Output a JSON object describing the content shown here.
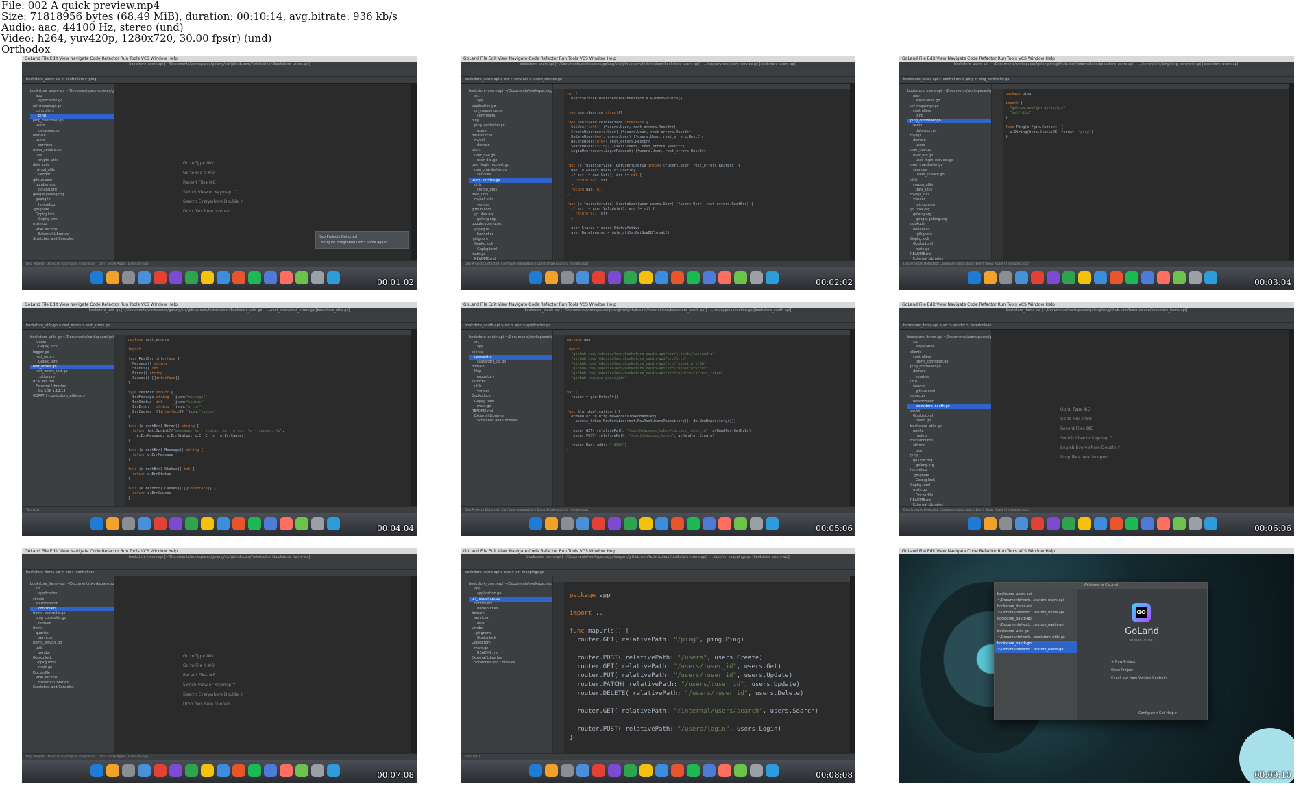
{
  "header": {
    "line1": "File: 002 A quick preview.mp4",
    "line2": "Size: 71818956 bytes (68.49 MiB), duration: 00:10:14, avg.bitrate: 936 kb/s",
    "line3": "Audio: aac, 44100 Hz, stereo (und)",
    "line4": "Video: h264, yuv420p, 1280x720, 30.00 fps(r) (und)",
    "line5": "Orthodox"
  },
  "mac_menu": "GoLand  File  Edit  View  Navigate  Code  Refactor  Run  Tools  VCS  Window  Help",
  "frames": [
    {
      "timestamp": "00:01:02",
      "title": "bookstore_users-api [~/Documents/workspaces/golang/src/github.com/federicoleon/bookstore_users-api]",
      "crumbs": "bookstore_users-api  >  controllers  >  ping",
      "tree": [
        "bookstore_users-api ~/Documents/workspaces/golang",
        "app",
        "application.go",
        "url_mappings.go",
        "controllers",
        "ping",
        "ping_controller.go",
        "users",
        "datasources",
        "domain",
        "users",
        "services",
        "users_service.go",
        "utils",
        "crypto_utils",
        "date_utils",
        "mysql_utils",
        "vendor",
        "github.com",
        "go.uber.org",
        "golang.org",
        "google.golang.org",
        "gopkg.in",
        "honnef.co",
        ".gitignore",
        "Gopkg.lock",
        "Gopkg.toml",
        "main.go",
        "README.md",
        "External Libraries",
        "Scratches and Consoles"
      ],
      "selected": 5,
      "welcome": [
        "Go to Type  ⌘O",
        "Go to File  ⇧⌘O",
        "Recent Files  ⌘E",
        "Switch View or Keymap  ^`",
        "Search Everywhere  Double ⇧",
        "Drop files here to open"
      ],
      "notify": [
        "Dep Projects Detected",
        "Configure integration   Don't Show Again"
      ],
      "status": "Dep Projects Detected: Configure integration | Don't Show Again (a minute ago)"
    },
    {
      "timestamp": "00:02:02",
      "title": "bookstore_users-api [~/Documents/workspaces/golang/src/github.com/federicoleon/bookstore_users-api] - .../src/services/users_service.go [bookstore_users-api]",
      "crumbs": "bookstore_users-api  >  src  >  services  >  users_service.go",
      "tree": [
        "bookstore_users-api ~/Documents/workspaces/golang",
        "src",
        "app",
        "application.go",
        "url_mappings.go",
        "controllers",
        "ping",
        "ping_controller.go",
        "users",
        "datasources",
        "mysql",
        "domain",
        "users",
        "user_dao.go",
        "user_dto.go",
        "user_login_request.go",
        "user_marshaller.go",
        "services",
        "users_service.go",
        "utils",
        "crypto_utils",
        "date_utils",
        "mysql_utils",
        "vendor",
        "github.com",
        "go.uber.org",
        "golang.org",
        "google.golang.org",
        "gopkg.in",
        "honnef.co",
        ".gitignore",
        "Gopkg.lock",
        "Gopkg.toml",
        "main.go",
        "README.md",
        "External Libraries"
      ],
      "selected": 18,
      "code": [
        "var (",
        "  UsersService usersServiceInterface = &usersService{}",
        ")",
        "",
        "type usersService struct{}",
        "",
        "type usersServiceInterface interface {",
        "  GetUser(int64) (*users.User, rest_errors.RestErr)",
        "  CreateUser(users.User) (*users.User, rest_errors.RestErr)",
        "  UpdateUser(bool, users.User) (*users.User, rest_errors.RestErr)",
        "  DeleteUser(int64) rest_errors.RestErr",
        "  SearchUser(string) (users.Users, rest_errors.RestErr)",
        "  LoginUser(users.LoginRequest) (*users.User, rest_errors.RestErr)",
        "}",
        "",
        "func (s *usersService) GetUser(userId int64) (*users.User, rest_errors.RestErr) {",
        "  dao := &users.User{Id: userId}",
        "  if err := dao.Get(); err != nil {",
        "    return nil, err",
        "  }",
        "  return dao, nil",
        "}",
        "",
        "func (s *usersService) CreateUser(user users.User) (*users.User, rest_errors.RestErr) {",
        "  if err := user.Validate(); err != nil {",
        "    return nil, err",
        "  }",
        "",
        "  user.Status = users.StatusActive",
        "  user.DateCreated = date_utils.GetNowDBFormat()"
      ],
      "status": "Dep Projects Detected: Configure integration | Don't Show Again (a minute ago)"
    },
    {
      "timestamp": "00:03:04",
      "title": "bookstore_users-api [~/Documents/workspaces/golang/src/github.com/federicoleon/bookstore_users-api] - .../controllers/ping/ping_controller.go [bookstore_users-api]",
      "crumbs": "bookstore_users-api  >  controllers  >  ping  >  ping_controller.go",
      "tree": [
        "bookstore_users-api ~/Documents/workspaces/golang",
        "app",
        "application.go",
        "url_mappings.go",
        "controllers",
        "ping",
        "ping_controller.go",
        "users",
        "datasources",
        "mysql",
        "domain",
        "users",
        "user_dao.go",
        "user_dto.go",
        "user_login_request.go",
        "user_marshaller.go",
        "services",
        "users_service.go",
        "utils",
        "crypto_utils",
        "date_utils",
        "mysql_utils",
        "vendor",
        "github.com",
        "go.uber.org",
        "golang.org",
        "google.golang.org",
        "gopkg.in",
        "honnef.co",
        ".gitignore",
        "Gopkg.lock",
        "Gopkg.toml",
        "main.go",
        "README.md",
        "External Libraries"
      ],
      "selected": 6,
      "code": [
        "package ping",
        "",
        "import (",
        "  \"github.com/gin-gonic/gin\"",
        "  \"net/http\"",
        ")",
        "",
        "func Ping(c *gin.Context) {",
        "  c.String(http.StatusOK, format: \"pong\")",
        "}"
      ],
      "status": "Dep Projects Detected: Configure integration | Don't Show Again (2 minutes ago)"
    },
    {
      "timestamp": "00:04:04",
      "title": "bookstore_utils-go [~/Documents/workspaces/golang/src/github.com/federicoleon/bookstore_utils-go] - .../rest_errors/rest_errors.go [bookstore_utils-go]",
      "crumbs": "bookstore_utils-go  >  rest_errors  >  rest_errors.go",
      "tree": [
        "bookstore_utils-go ~/Documents/workspaces/golang",
        "logger",
        "Gopkg.lock",
        "logger.go",
        "rest_errors",
        "Gopkg.toml",
        "rest_errors.go",
        "rest_errors_test.go",
        ".gitignore",
        "README.md",
        "External Libraries",
        "Go SDK 1.12.13",
        "GOPATH <bookstore_utils-go>"
      ],
      "selected": 6,
      "code": [
        "package rest_errors",
        "",
        "import ...",
        "",
        "type RestErr interface {",
        "  Message() string",
        "  Status() int",
        "  Error() string",
        "  Causes() []interface{}",
        "}",
        "",
        "type restErr struct {",
        "  ErrMessage string  `json:\"message\"`",
        "  ErrStatus  int     `json:\"status\"`",
        "  ErrError   string  `json:\"error\"`",
        "  ErrCauses  []interface{} `json:\"causes\"`",
        "}",
        "",
        "func (e restErr) Error() string {",
        "  return fmt.Sprintf(\"message: %s - status: %d - error: %s - causes: %v\",",
        "    e.ErrMessage, e.ErrStatus, e.ErrError, e.ErrCauses)",
        "}",
        "",
        "func (e restErr) Message() string {",
        "  return e.ErrMessage",
        "}",
        "",
        "func (e restErr) Status() int {",
        "  return e.ErrStatus",
        "}",
        "",
        "func (e restErr) Causes() []interface{} {",
        "  return e.ErrCauses",
        "}",
        "",
        "func NewRestError(message string, status int, err string, causes []interface{}) RestErr {",
        "  return restErr{",
        "    ErrMessage: message,",
        "    ErrStatus:  status,",
        "    ErrError:   err,",
        "    ErrCauses:  causes,",
        "  }",
        "}"
      ],
      "status": "Terminal"
    },
    {
      "timestamp": "00:05:06",
      "title": "bookstore_oauth-api [~/Documents/workspaces/golang/src/github.com/federicoleon/bookstore_oauth-api] - .../src/app/application.go [bookstore_oauth-api]",
      "crumbs": "bookstore_oauth-api  >  src  >  app  >  application.go",
      "tree": [
        "bookstore_oauth-api ~/Documents/workspaces/golang",
        "src",
        "app",
        "clients",
        "cassandra",
        "cassandra_db.go",
        "domain",
        "http",
        "repository",
        "services",
        "utils",
        "vendor",
        "Gopkg.lock",
        "Gopkg.toml",
        "main.go",
        "README.md",
        "External Libraries",
        "Scratches and Consoles"
      ],
      "selected": 4,
      "code": [
        "package app",
        "",
        "import (",
        "  \"github.com/federicoleon/bookstore_oauth-api/src/clients/cassandra\"",
        "  \"github.com/federicoleon/bookstore_oauth-api/src/http\"",
        "  \"github.com/federicoleon/bookstore_oauth-api/src/repository/db\"",
        "  \"github.com/federicoleon/bookstore_oauth-api/src/repository/rest\"",
        "  \"github.com/federicoleon/bookstore_oauth-api/src/services/access_token\"",
        "  \"github.com/gin-gonic/gin\"",
        ")",
        "",
        "var (",
        "  router = gin.Default()",
        ")",
        "",
        "func StartApplication() {",
        "  atHandler := http.NewAccessTokenHandler(",
        "    access_token.NewService(rest.NewRestUsersRepository(), db.NewRepository()))",
        "",
        "  router.GET( relativePath: \"/oauth/access_token/:access_token_id\", atHandler.GetById)",
        "  router.POST( relativePath: \"/oauth/access_token\", atHandler.Create)",
        "",
        "  router.Run( addr: \":8080\")",
        "}"
      ],
      "status": "Dep Projects Detected: Configure integration | Don't Show Again (a minute ago)"
    },
    {
      "timestamp": "00:06:06",
      "title": "bookstore_items-api [~/Documents/workspaces/golang/src/github.com/federicoleon/bookstore_items-api]",
      "crumbs": "bookstore_items-api  >  src  >  vendor  >  federicoleon",
      "tree": [
        "bookstore_items-api ~/Documents/workspaces/golang",
        "src",
        "application",
        "clients",
        "controllers",
        "items_controller.go",
        "ping_controller.go",
        "domain",
        "services",
        "utils",
        "vendor",
        "github.com",
        "davecgh",
        "federicoleon",
        "bookstore_oauth-go",
        "oauth",
        "Gopkg.toml",
        "oauth.go",
        "bookstore_utils-go",
        "gorilla",
        "mailru",
        "mercadolibre",
        "olivere",
        "pkg",
        "ping",
        "go.uber.org",
        "golang.org",
        "honnef.co",
        ".gitignore",
        "Gopkg.lock",
        "Gopkg.toml",
        "main.go",
        "Dockerfile",
        "README.md",
        "External Libraries",
        "Scratches and Consoles"
      ],
      "selected": 14,
      "welcome": [
        "Go to Type  ⌘O",
        "Go to File  ⇧⌘O",
        "Recent Files  ⌘E",
        "Switch View or Keymap  ^`",
        "Search Everywhere  Double ⇧",
        "Drop files here to open"
      ],
      "status": "Dep Projects Detected: Configure integration | Don't Show Again (2 minutes ago)"
    },
    {
      "timestamp": "00:07:08",
      "title": "bookstore_items-api [~/Documents/workspaces/golang/src/github.com/federicoleon/bookstore_items-api]",
      "crumbs": "bookstore_items-api  >  src  >  controllers",
      "tree": [
        "bookstore_items-api ~/Documents/workspaces/golang",
        "src",
        "application",
        "clients",
        "elasticsearch",
        "controllers",
        "items_controller.go",
        "ping_controller.go",
        "domain",
        "items",
        "queries",
        "services",
        "items_service.go",
        "utils",
        "vendor",
        "Gopkg.lock",
        "Gopkg.toml",
        "main.go",
        "Dockerfile",
        "README.md",
        "External Libraries",
        "Scratches and Consoles"
      ],
      "selected": 5,
      "welcome": [
        "Go to Type  ⌘O",
        "Go to File  ⇧⌘O",
        "Recent Files  ⌘E",
        "Switch View or Keymap  ^`",
        "Search Everywhere  Double ⇧",
        "Drop files here to open"
      ],
      "status": "Dep Projects Detected: Configure integration | Don't Show Again (a minute ago)"
    },
    {
      "timestamp": "00:08:08",
      "title": "bookstore_users-api [~/Documents/workspaces/golang/src/github.com/federicoleon/bookstore_users-api] - .../app/url_mappings.go [bookstore_users-api]",
      "crumbs": "bookstore_users-api  >  app  >  url_mappings.go",
      "tree": [
        "bookstore_users-api ~/Documents/workspaces/golang",
        "app",
        "application.go",
        "url_mappings.go",
        "controllers",
        "datasources",
        "domain",
        "services",
        "utils",
        "vendor",
        ".gitignore",
        "Gopkg.lock",
        "Gopkg.toml",
        "main.go",
        "README.md",
        "External Libraries",
        "Scratches and Consoles"
      ],
      "selected": 3,
      "code": [
        "package app",
        "",
        "import ...",
        "",
        "func mapUrls() {",
        "  router.GET( relativePath: \"/ping\", ping.Ping)",
        "",
        "  router.POST( relativePath: \"/users\", users.Create)",
        "  router.GET( relativePath: \"/users/:user_id\", users.Get)",
        "  router.PUT( relativePath: \"/users/:user_id\", users.Update)",
        "  router.PATCH( relativePath: \"/users/:user_id\", users.Update)",
        "  router.DELETE( relativePath: \"/users/:user_id\", users.Delete)",
        "",
        "  router.GET( relativePath: \"/internal/users/search\", users.Search)",
        "",
        "  router.POST( relativePath: \"/users/login\", users.Login)",
        "}"
      ],
      "status": "mapUrls()"
    },
    {
      "timestamp": "00:09:10",
      "welcome_dialog": {
        "title": "Welcome to GoLand",
        "projects": [
          "bookstore_users-api",
          "~/Documents/work...okstore_users-api",
          "bookstore_items-api",
          "~/Documents/work...okstore_items-api",
          "bookstore_oauth-api",
          "~/Documents/work...okstore_oauth-api",
          "bookstore_utils-go",
          "~/Documents/work...bookstore_utils-go",
          "bookstore_oauth-go",
          "~/Documents/work...okstore_oauth-go"
        ],
        "selected": 8,
        "logo": "GO",
        "name": "GoLand",
        "version": "Version 2019.2",
        "actions": [
          "+ New Project",
          "Open Project",
          "Check out from Version Control ▾"
        ],
        "footer": "Configure ▾    Get Help ▾"
      }
    }
  ]
}
